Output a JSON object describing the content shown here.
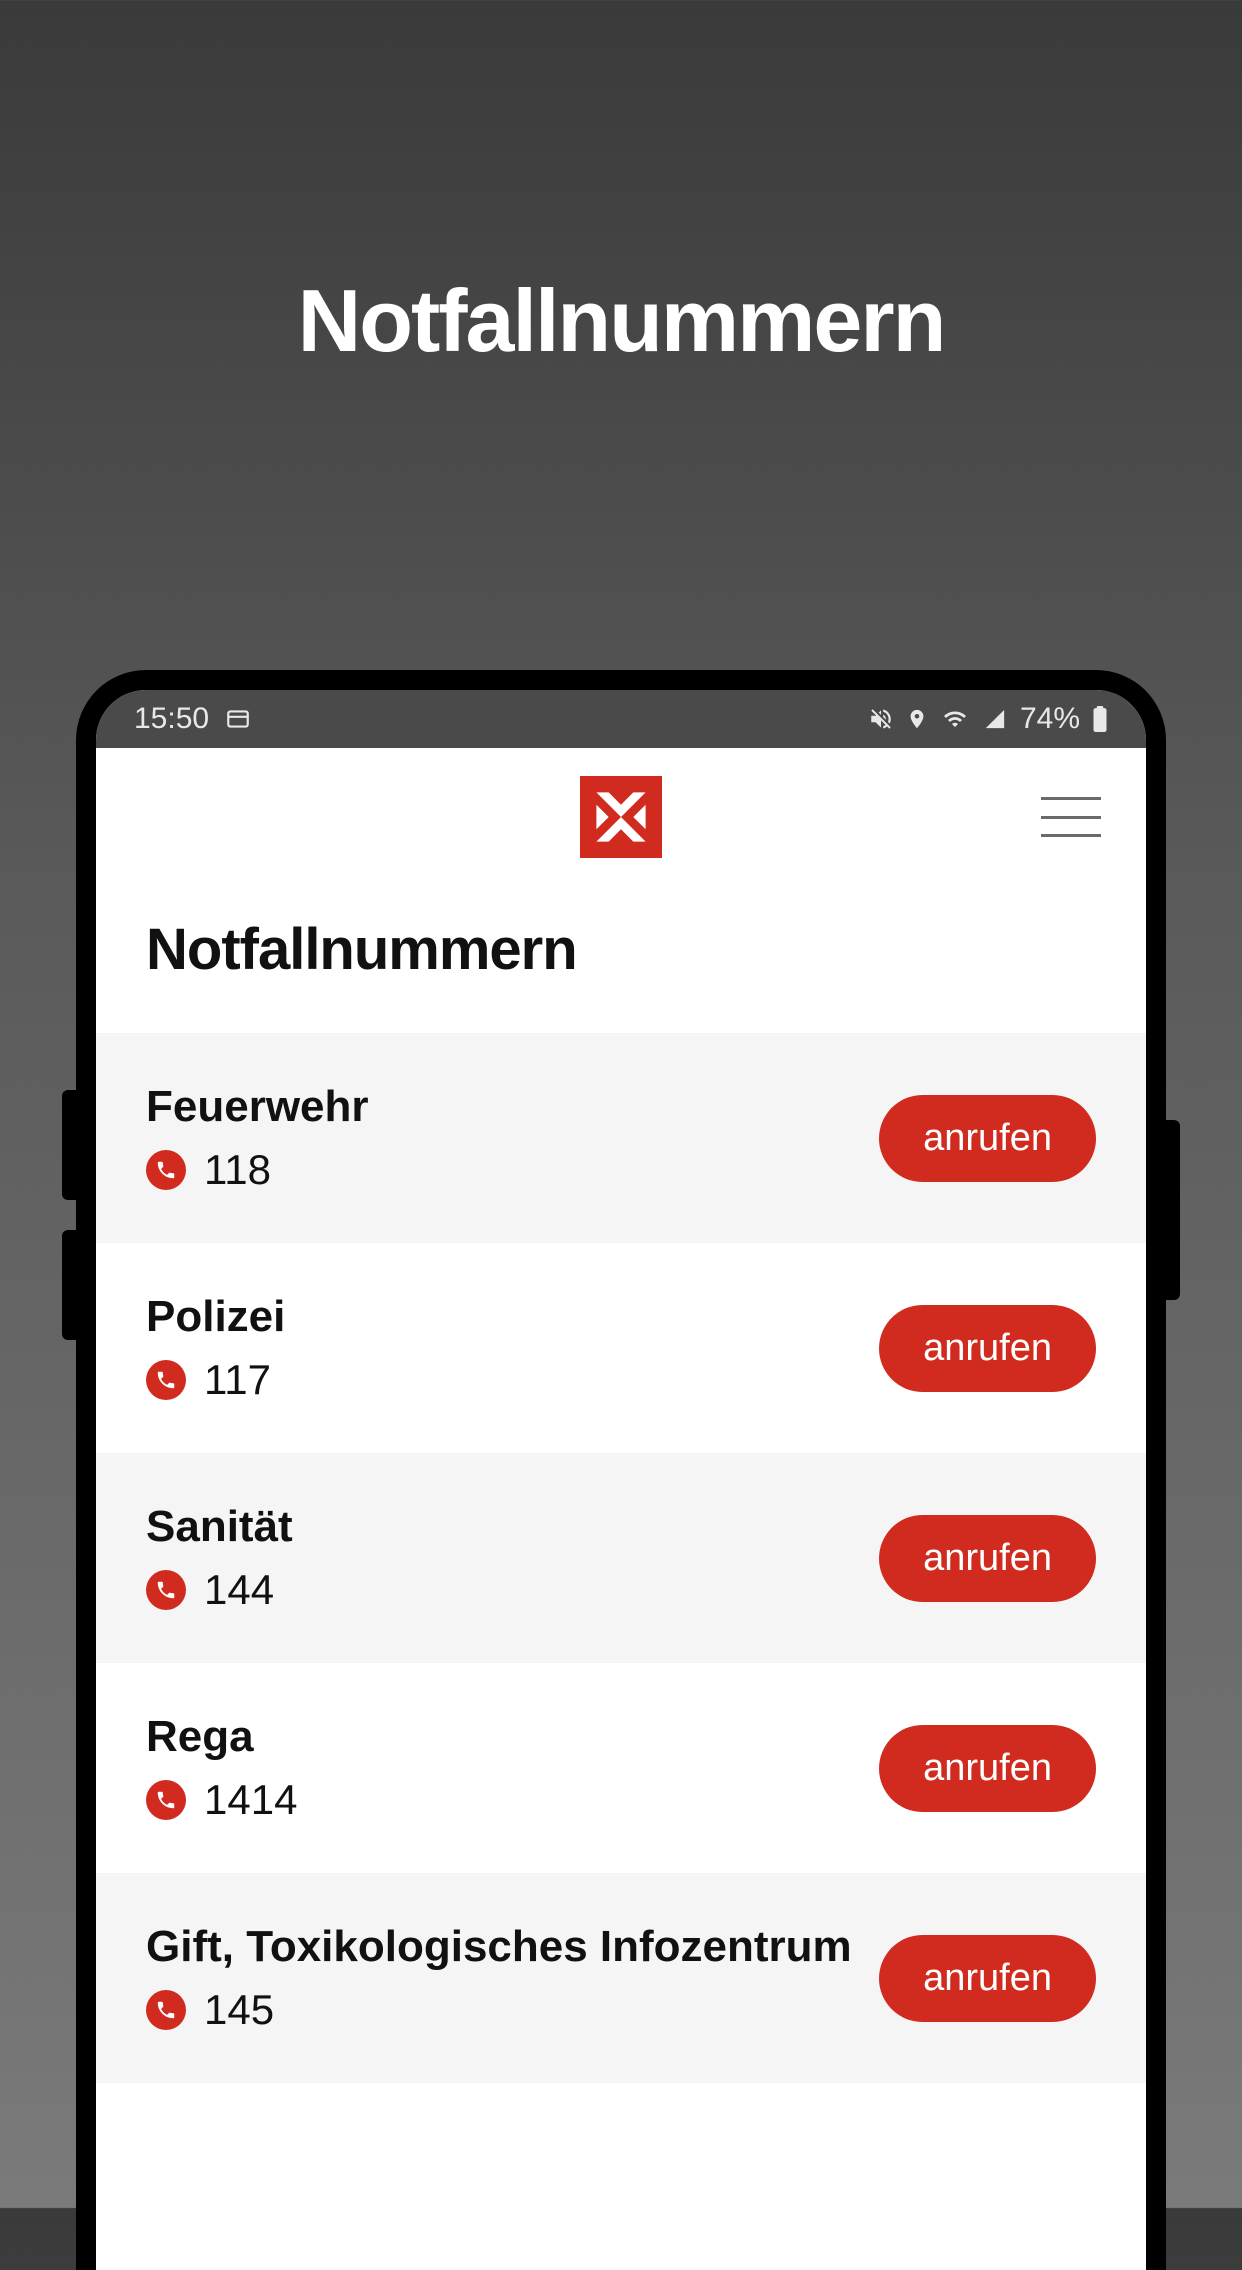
{
  "promo": {
    "title": "Notfallnummern"
  },
  "status_bar": {
    "time": "15:50",
    "battery": "74%"
  },
  "app": {
    "page_title": "Notfallnummern",
    "call_label": "anrufen"
  },
  "emergency_contacts": [
    {
      "name": "Feuerwehr",
      "number": "118"
    },
    {
      "name": "Polizei",
      "number": "117"
    },
    {
      "name": "Sanität",
      "number": "144"
    },
    {
      "name": "Rega",
      "number": "1414"
    },
    {
      "name": "Gift, Toxikologisches Infozentrum",
      "number": "145"
    }
  ]
}
